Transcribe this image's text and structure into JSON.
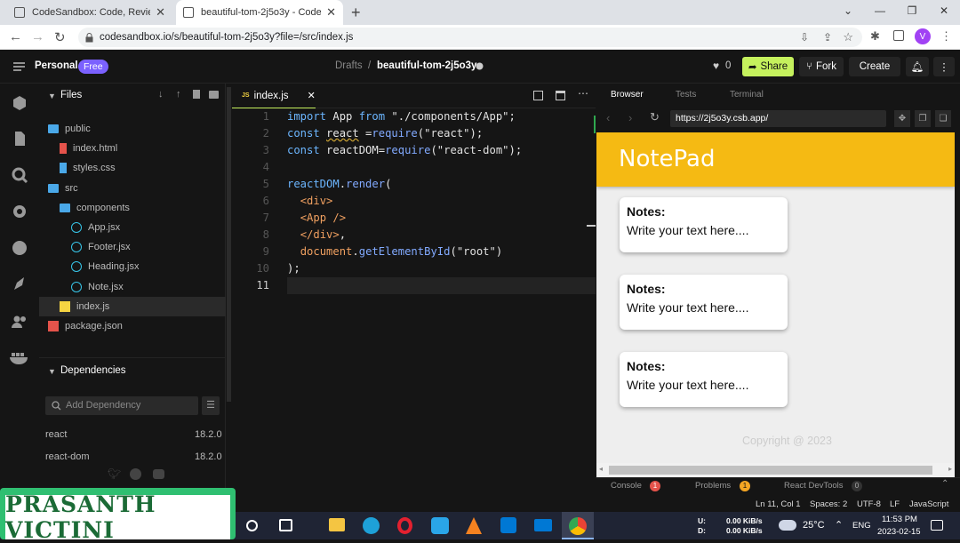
{
  "browser": {
    "tabs": [
      {
        "title": "CodeSandbox: Code, Review and"
      },
      {
        "title": "beautiful-tom-2j5o3y - CodeSan"
      }
    ],
    "url": "codesandbox.io/s/beautiful-tom-2j5o3y?file=/src/index.js",
    "profile_initial": "V"
  },
  "header": {
    "workspace": "Personal",
    "plan_badge": "Free",
    "breadcrumb_folder": "Drafts",
    "breadcrumb_sep": "/",
    "sandbox_name": "beautiful-tom-2j5o3y",
    "likes": "0",
    "share": "Share",
    "fork": "Fork",
    "create": "Create"
  },
  "explorer": {
    "files_title": "Files",
    "tree": [
      {
        "name": "public",
        "type": "folder"
      },
      {
        "name": "index.html",
        "type": "html"
      },
      {
        "name": "styles.css",
        "type": "css"
      },
      {
        "name": "src",
        "type": "folder"
      },
      {
        "name": "components",
        "type": "folder"
      },
      {
        "name": "App.jsx",
        "type": "react"
      },
      {
        "name": "Footer.jsx",
        "type": "react"
      },
      {
        "name": "Heading.jsx",
        "type": "react"
      },
      {
        "name": "Note.jsx",
        "type": "react"
      },
      {
        "name": "index.js",
        "type": "js"
      },
      {
        "name": "package.json",
        "type": "json"
      }
    ],
    "deps_title": "Dependencies",
    "add_dep_placeholder": "Add Dependency",
    "dependencies": [
      {
        "name": "react",
        "version": "18.2.0"
      },
      {
        "name": "react-dom",
        "version": "18.2.0"
      }
    ]
  },
  "editor": {
    "tab_badge": "JS",
    "tab_name": "index.js",
    "line_numbers": [
      "1",
      "2",
      "3",
      "4",
      "5",
      "6",
      "7",
      "8",
      "9",
      "10",
      "11"
    ]
  },
  "preview": {
    "tabs": [
      "Browser",
      "Tests",
      "Terminal"
    ],
    "url": "https://2j5o3y.csb.app/",
    "app_title": "NotePad",
    "notes": [
      {
        "title": "Notes:",
        "content": "Write your text here...."
      },
      {
        "title": "Notes:",
        "content": "Write your text here...."
      },
      {
        "title": "Notes:",
        "content": "Write your text here...."
      }
    ],
    "footer": "Copyright @ 2023"
  },
  "bottom_panel": {
    "console": "Console",
    "console_count": "1",
    "problems": "Problems",
    "problems_count": "1",
    "devtools": "React DevTools",
    "devtools_count": "0"
  },
  "statusbar": {
    "position": "Ln 11, Col 1",
    "spaces": "Spaces: 2",
    "encoding": "UTF-8",
    "eol": "LF",
    "language": "JavaScript"
  },
  "taskbar": {
    "net_up_label": "U:",
    "net_up": "0.00 KiB/s",
    "net_down_label": "D:",
    "net_down": "0.00 KiB/s",
    "temperature": "25°C",
    "lang": "ENG",
    "time": "11:53 PM",
    "date": "2023-02-15"
  },
  "watermark": "PRASANTH VICTINI",
  "colors": {
    "notepad_header": "#f5ba13",
    "share_green": "#c5f15d",
    "free_badge": "#7b61ff"
  }
}
